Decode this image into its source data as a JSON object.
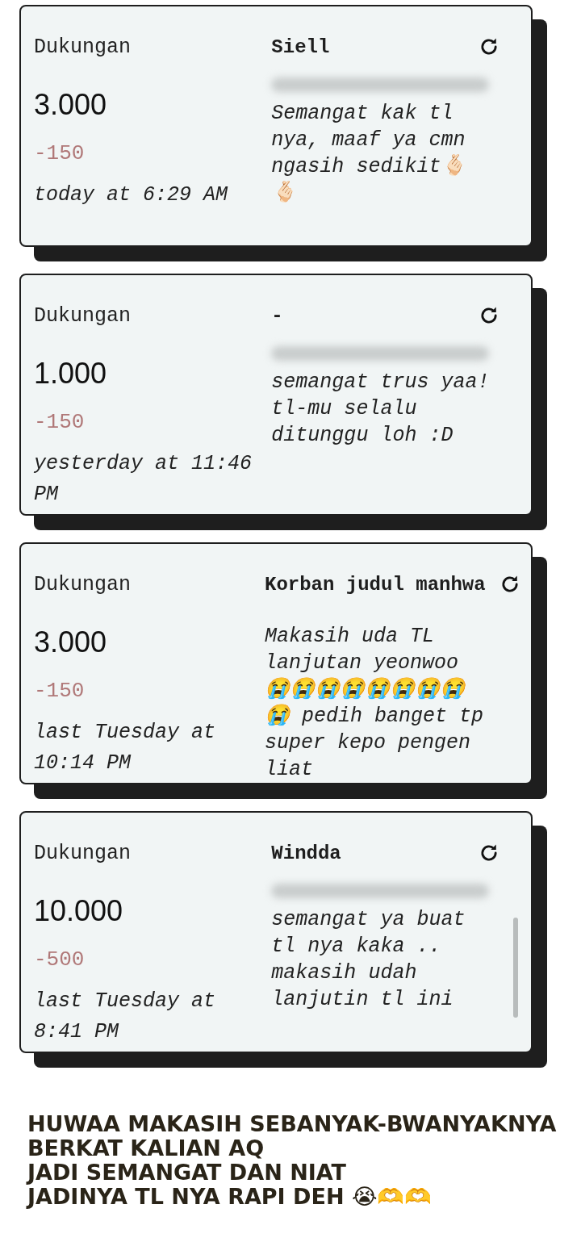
{
  "cards": [
    {
      "label": "Dukungan",
      "amount": "3.000",
      "fee": "-150",
      "time": "today at 6:29 AM",
      "name": "Siell",
      "message": "Semangat kak tl nya, maaf ya cmn ngasih sedikit🫰🏻🫰🏻"
    },
    {
      "label": "Dukungan",
      "amount": "1.000",
      "fee": "-150",
      "time": "yesterday at 11:46 PM",
      "name": "-",
      "message": "semangat trus yaa! tl-mu selalu ditunggu loh :D"
    },
    {
      "label": "Dukungan",
      "amount": "3.000",
      "fee": "-150",
      "time": "last Tuesday at 10:14 PM",
      "name": "Korban judul manhwa",
      "message": "Makasih uda TL lanjutan yeonwoo 😭😭😭😭😭😭😭😭😭 pedih banget tp super kepo pengen liat"
    },
    {
      "label": "Dukungan",
      "amount": "10.000",
      "fee": "-500",
      "time": "last Tuesday at 8:41 PM",
      "name": "Windda",
      "message": "semangat ya buat tl nya kaka .. makasih udah lanjutin tl ini"
    }
  ],
  "caption": "HUWAA MAKASIH SEBANYAK-BWANYAKNYA\nBERKAT KALIAN AQ\nJADI SEMANGAT DAN NIAT\nJADINYA TL NYA RAPI DEH 😭🫶🫶"
}
